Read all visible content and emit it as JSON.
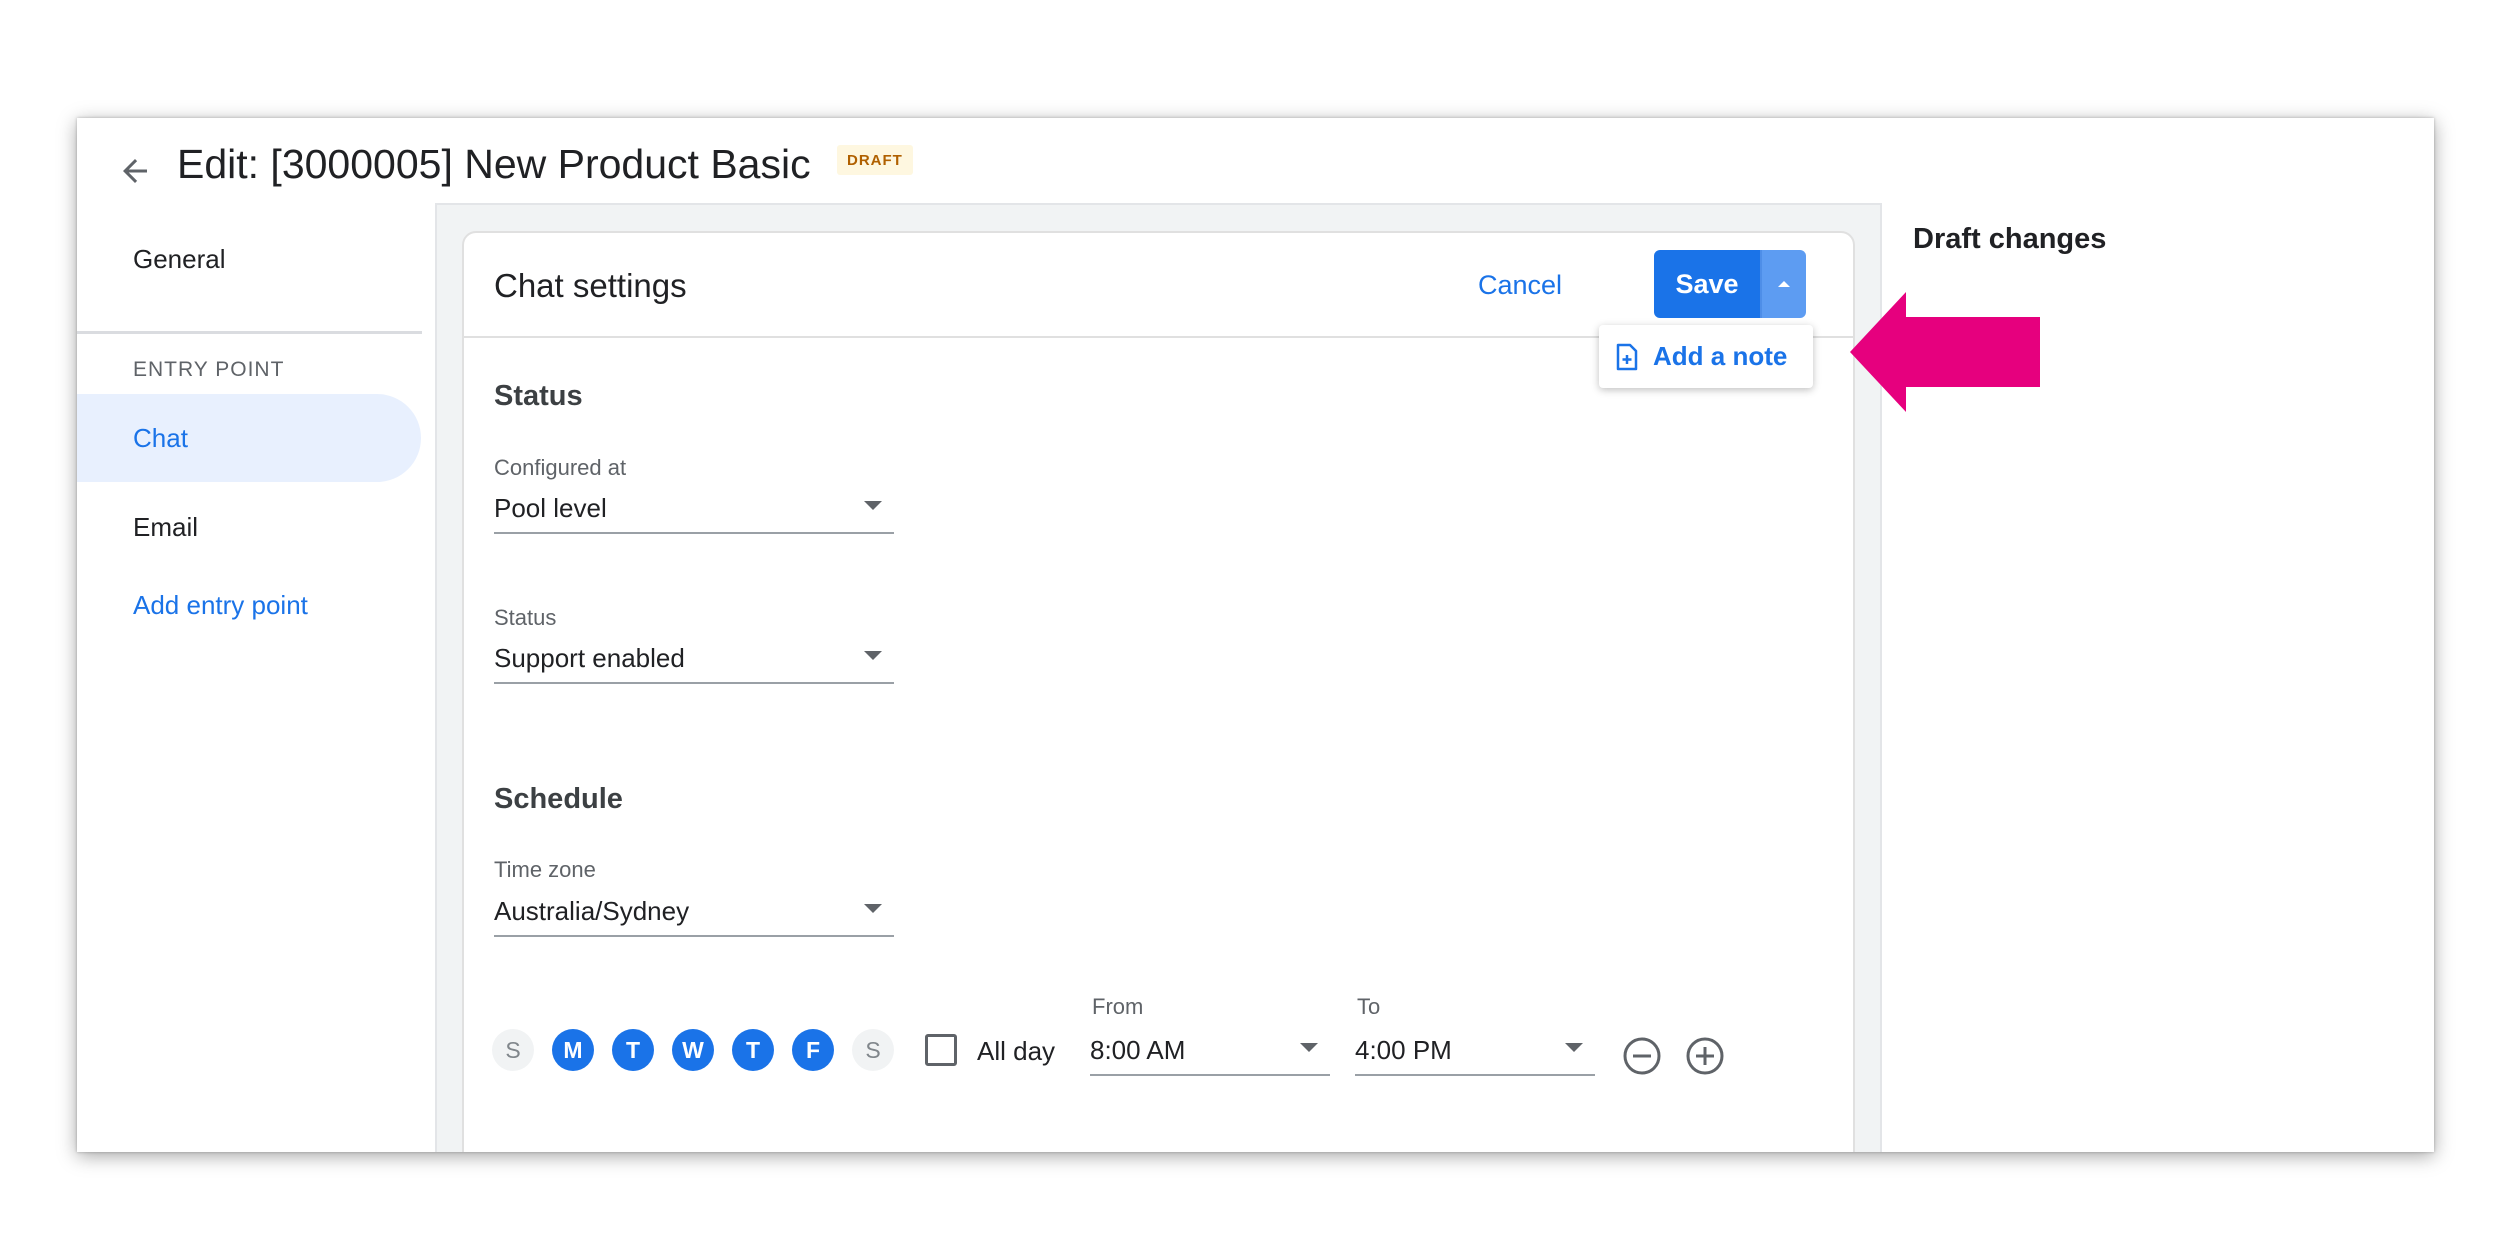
{
  "header": {
    "title": "Edit: [3000005] New Product Basic",
    "badge": "DRAFT"
  },
  "nav": {
    "general": "General",
    "section_label": "ENTRY POINT",
    "items": [
      {
        "label": "Chat",
        "active": true
      },
      {
        "label": "Email",
        "active": false
      }
    ],
    "add_entry_point": "Add entry point"
  },
  "card": {
    "title": "Chat settings",
    "cancel_label": "Cancel",
    "save_label": "Save",
    "menu": {
      "add_note_label": "Add a note"
    },
    "status_section": {
      "heading": "Status",
      "configured_at": {
        "label": "Configured at",
        "value": "Pool level"
      },
      "status": {
        "label": "Status",
        "value": "Support enabled"
      }
    },
    "schedule_section": {
      "heading": "Schedule",
      "time_zone": {
        "label": "Time zone",
        "value": "Australia/Sydney"
      },
      "days": [
        {
          "letter": "S",
          "selected": false
        },
        {
          "letter": "M",
          "selected": true
        },
        {
          "letter": "T",
          "selected": true
        },
        {
          "letter": "W",
          "selected": true
        },
        {
          "letter": "T",
          "selected": true
        },
        {
          "letter": "F",
          "selected": true
        },
        {
          "letter": "S",
          "selected": false
        }
      ],
      "all_day_label": "All day",
      "from": {
        "label": "From",
        "value": "8:00 AM"
      },
      "to": {
        "label": "To",
        "value": "4:00 PM"
      }
    }
  },
  "side_panel": {
    "title": "Draft changes"
  },
  "colors": {
    "primary": "#1a73e8",
    "active_nav_bg": "#e8f0fe",
    "draft_badge_bg": "#fef7e0",
    "draft_badge_text": "#b06000",
    "annotation_arrow": "#e6007e"
  }
}
